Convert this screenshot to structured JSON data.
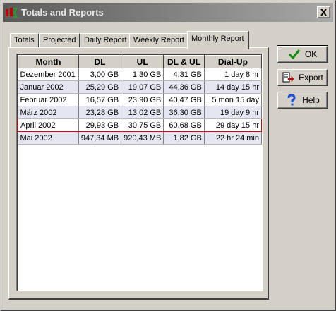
{
  "window": {
    "title": "Totals and Reports",
    "close_glyph": "X"
  },
  "tabs": [
    {
      "label": "Totals"
    },
    {
      "label": "Projected"
    },
    {
      "label": "Daily Report"
    },
    {
      "label": "Weekly Report"
    },
    {
      "label": "Monthly Report",
      "active": true
    }
  ],
  "table": {
    "columns": [
      "Month",
      "DL",
      "UL",
      "DL & UL",
      "Dial-Up"
    ],
    "rows": [
      [
        "Dezember 2001",
        "3,00 GB",
        "1,30 GB",
        "4,31 GB",
        "1 day 8 hr"
      ],
      [
        "Januar 2002",
        "25,29 GB",
        "19,07 GB",
        "44,36 GB",
        "14 day 15 hr"
      ],
      [
        "Februar 2002",
        "16,57 GB",
        "23,90 GB",
        "40,47 GB",
        "5 mon 15 day"
      ],
      [
        "März 2002",
        "23,28 GB",
        "13,02 GB",
        "36,30 GB",
        "19 day 9 hr"
      ],
      [
        "April 2002",
        "29,93 GB",
        "30,75 GB",
        "60,68 GB",
        "29 day 15 hr"
      ],
      [
        "Mai 2002",
        "947,34 MB",
        "920,43 MB",
        "1,82 GB",
        "22 hr 24 min"
      ]
    ],
    "selected_row": "April 2002"
  },
  "buttons": {
    "ok": {
      "label": "OK",
      "icon": "checkmark-icon"
    },
    "export": {
      "label": "Export",
      "icon": "export-icon"
    },
    "help": {
      "label": "Help",
      "icon": "question-mark-icon"
    }
  },
  "colors": {
    "alt_row": "#e6e6f3",
    "selection_outline": "#dd0000",
    "ok_check": "#138a13",
    "help_icon": "#1f4fd8"
  }
}
